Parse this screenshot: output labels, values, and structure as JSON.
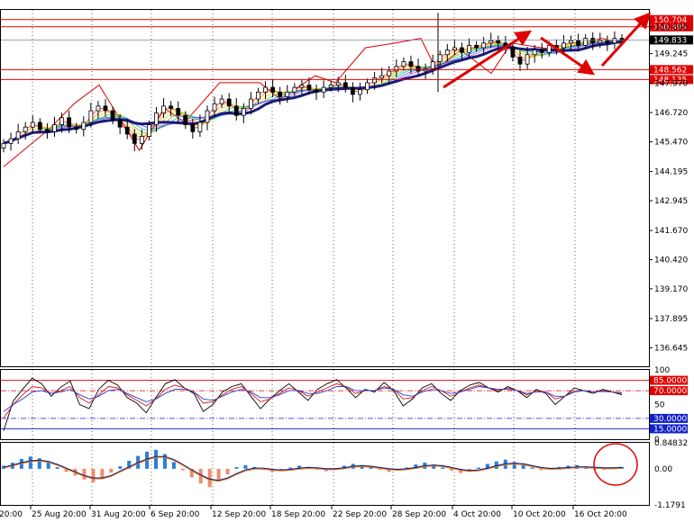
{
  "chart_data": [
    {
      "type": "candlestick",
      "panel": "price",
      "price_ticks": [
        "150.395",
        "149.245",
        "147.970",
        "146.720",
        "145.470",
        "144.195",
        "142.945",
        "141.670",
        "140.420",
        "139.170",
        "137.895",
        "136.645"
      ],
      "price_tick_values": [
        150.395,
        149.245,
        147.97,
        146.72,
        145.47,
        144.195,
        142.945,
        141.67,
        140.42,
        139.17,
        137.895,
        136.645
      ],
      "ylim": [
        135.85,
        151.12
      ],
      "current_price": {
        "label": "149.833",
        "value": 149.833
      },
      "levels": [
        {
          "label": "150.704",
          "value": 150.704,
          "color": "#e00000"
        },
        {
          "label": "150.395",
          "value": 150.395,
          "color": "#e00000"
        },
        {
          "label": "148.562",
          "value": 148.562,
          "color": "#e00000"
        },
        {
          "label": "148.135",
          "value": 148.135,
          "color": "#e00000"
        }
      ],
      "zigzag_points": [
        [
          0,
          144.4
        ],
        [
          9,
          146.0
        ],
        [
          14,
          147.1
        ],
        [
          19,
          147.9
        ],
        [
          27,
          145.1
        ],
        [
          32,
          146.9
        ],
        [
          36,
          146.3
        ],
        [
          43,
          148.0
        ],
        [
          51,
          148.0
        ],
        [
          55,
          147.3
        ],
        [
          62,
          148.3
        ],
        [
          66,
          148.0
        ],
        [
          72,
          149.5
        ],
        [
          78,
          149.7
        ],
        [
          83,
          149.9
        ],
        [
          86,
          148.6
        ],
        [
          91,
          149.4
        ],
        [
          97,
          148.4
        ],
        [
          101,
          149.7
        ],
        [
          110,
          149.4
        ],
        [
          119,
          149.9
        ],
        [
          123,
          149.7
        ]
      ],
      "close": [
        145.4,
        145.6,
        145.9,
        146.1,
        146.3,
        146.0,
        145.9,
        146.2,
        146.5,
        146.1,
        146.0,
        146.3,
        146.8,
        147.0,
        146.8,
        146.4,
        146.1,
        145.8,
        145.4,
        145.7,
        146.2,
        146.7,
        147.0,
        146.9,
        146.6,
        146.2,
        145.9,
        146.3,
        146.8,
        147.1,
        147.3,
        147.0,
        146.6,
        146.9,
        147.3,
        147.6,
        147.8,
        147.6,
        147.4,
        147.6,
        147.8,
        147.9,
        147.7,
        147.6,
        147.8,
        147.9,
        148.0,
        147.8,
        147.5,
        147.7,
        148.0,
        148.2,
        148.3,
        148.5,
        148.7,
        148.9,
        148.7,
        148.5,
        148.6,
        148.9,
        149.2,
        149.4,
        149.5,
        149.3,
        149.6,
        149.5,
        149.7,
        149.8,
        149.7,
        149.5,
        149.1,
        148.8,
        149.2,
        149.4,
        149.3,
        149.6,
        149.5,
        149.7,
        149.8,
        149.6,
        149.9,
        149.7,
        149.8,
        149.7,
        149.9,
        149.8
      ],
      "x_ticks": [
        "20:00",
        "25 Aug 20:00",
        "31 Aug 20:00",
        "6 Sep 20:00",
        "12 Sep 20:00",
        "18 Sep 20:00",
        "22 Sep 20:00",
        "28 Sep 20:00",
        "4 Oct 20:00",
        "10 Oct 20:00",
        "16 Oct 20:00"
      ]
    },
    {
      "type": "line",
      "panel": "oscillator",
      "ticks": [
        "100",
        "85.0000",
        "70.0000",
        "50",
        "30.0000",
        "15.0000",
        "0"
      ],
      "tick_values": [
        100,
        85,
        70,
        50,
        30,
        15,
        0
      ],
      "ylim": [
        0,
        100
      ],
      "levels": [
        85,
        70,
        30,
        15
      ],
      "series": [
        {
          "color": "#000000",
          "values": [
            12,
            55,
            72,
            88,
            80,
            62,
            75,
            84,
            50,
            44,
            72,
            85,
            78,
            60,
            52,
            38,
            60,
            80,
            86,
            74,
            66,
            40,
            50,
            68,
            76,
            80,
            62,
            44,
            58,
            70,
            80,
            68,
            56,
            72,
            80,
            86,
            74,
            60,
            72,
            68,
            82,
            70,
            48,
            58,
            74,
            80,
            66,
            56,
            70,
            78,
            82,
            74,
            68,
            76,
            70,
            60,
            72,
            66,
            50,
            62,
            74,
            70,
            66,
            72,
            68,
            64
          ]
        },
        {
          "color": "#d01818",
          "values": [
            30,
            50,
            64,
            76,
            74,
            66,
            70,
            76,
            60,
            52,
            64,
            76,
            74,
            64,
            56,
            48,
            58,
            72,
            78,
            74,
            68,
            52,
            54,
            64,
            72,
            76,
            66,
            54,
            58,
            66,
            74,
            70,
            62,
            68,
            74,
            80,
            76,
            66,
            70,
            70,
            76,
            72,
            58,
            60,
            70,
            76,
            70,
            62,
            68,
            74,
            78,
            74,
            70,
            74,
            70,
            64,
            70,
            68,
            58,
            62,
            70,
            70,
            68,
            70,
            68,
            66
          ]
        },
        {
          "color": "#2a3cd0",
          "values": [
            40,
            50,
            58,
            68,
            70,
            66,
            68,
            72,
            64,
            58,
            62,
            70,
            72,
            66,
            60,
            54,
            58,
            66,
            72,
            72,
            68,
            58,
            56,
            62,
            68,
            72,
            68,
            60,
            60,
            64,
            70,
            70,
            66,
            66,
            70,
            76,
            76,
            70,
            70,
            70,
            74,
            72,
            64,
            62,
            68,
            72,
            70,
            66,
            68,
            72,
            76,
            74,
            72,
            72,
            70,
            66,
            68,
            68,
            62,
            62,
            68,
            70,
            68,
            69,
            68,
            67
          ]
        }
      ]
    },
    {
      "type": "bar",
      "panel": "macd",
      "ticks": [
        "0.84832",
        "0.00",
        "-1.1791"
      ],
      "tick_values": [
        0.84832,
        0.0,
        -1.1791
      ],
      "ylim": [
        -1.1791,
        0.84832
      ],
      "values": [
        0.1,
        0.2,
        0.32,
        0.4,
        0.34,
        0.2,
        0.05,
        -0.1,
        -0.22,
        -0.35,
        -0.44,
        -0.3,
        -0.12,
        0.08,
        0.26,
        0.42,
        0.56,
        0.62,
        0.48,
        0.22,
        -0.05,
        -0.28,
        -0.48,
        -0.6,
        -0.4,
        -0.18,
        0.05,
        0.12,
        0.06,
        -0.04,
        -0.1,
        -0.06,
        0.04,
        0.1,
        0.06,
        -0.02,
        -0.08,
        0.02,
        0.1,
        0.16,
        0.12,
        0.04,
        -0.04,
        -0.1,
        -0.06,
        0.04,
        0.14,
        0.2,
        0.14,
        0.04,
        -0.06,
        -0.14,
        -0.08,
        0.04,
        0.16,
        0.24,
        0.3,
        0.22,
        0.12,
        0.04,
        -0.04,
        -0.02,
        0.06,
        0.1,
        0.12,
        0.08,
        0.02,
        -0.02,
        0.04,
        0.06
      ],
      "signal": [
        0.05,
        0.12,
        0.2,
        0.26,
        0.28,
        0.24,
        0.14,
        0.02,
        -0.1,
        -0.22,
        -0.3,
        -0.3,
        -0.22,
        -0.08,
        0.06,
        0.2,
        0.32,
        0.4,
        0.4,
        0.3,
        0.14,
        -0.04,
        -0.2,
        -0.34,
        -0.38,
        -0.3,
        -0.16,
        -0.04,
        0.02,
        0.02,
        -0.02,
        -0.04,
        -0.02,
        0.02,
        0.04,
        0.03,
        0.0,
        0.0,
        0.03,
        0.08,
        0.1,
        0.08,
        0.04,
        0.0,
        -0.02,
        0.0,
        0.04,
        0.1,
        0.12,
        0.1,
        0.04,
        -0.02,
        -0.06,
        -0.04,
        0.02,
        0.1,
        0.16,
        0.18,
        0.16,
        0.1,
        0.04,
        0.01,
        0.02,
        0.04,
        0.06,
        0.06,
        0.05,
        0.03,
        0.03,
        0.04
      ]
    }
  ],
  "colors": {
    "level_red": "#e00000",
    "current_price_tag": "#000000",
    "osc_upper": "#e00000",
    "osc_lower": "#1020c8",
    "macd_pos": "#2a7fd6",
    "macd_neg": "#f08c6c"
  }
}
